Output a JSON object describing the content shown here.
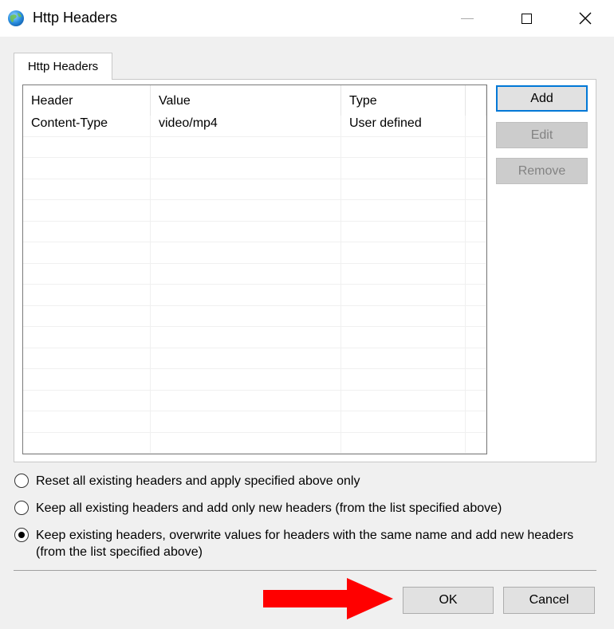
{
  "window": {
    "title": "Http Headers",
    "icon": "globe-icon",
    "controls": {
      "minimize_icon": "minimize-icon",
      "maximize_icon": "maximize-icon",
      "close_icon": "close-icon"
    }
  },
  "tabs": [
    {
      "label": "Http Headers",
      "active": true
    }
  ],
  "table": {
    "columns": [
      "Header",
      "Value",
      "Type"
    ],
    "rows": [
      {
        "header": "Content-Type",
        "value": "video/mp4",
        "type": "User defined"
      }
    ]
  },
  "side_buttons": {
    "add": {
      "label": "Add",
      "enabled": true
    },
    "edit": {
      "label": "Edit",
      "enabled": false
    },
    "remove": {
      "label": "Remove",
      "enabled": false
    }
  },
  "options": [
    {
      "label": "Reset all existing headers and apply specified above only",
      "selected": false
    },
    {
      "label": "Keep all existing headers and add only new headers (from the list specified above)",
      "selected": false
    },
    {
      "label": "Keep existing headers, overwrite values for headers with the same name and add new headers (from the list specified above)",
      "selected": true
    }
  ],
  "footer": {
    "ok_label": "OK",
    "cancel_label": "Cancel"
  },
  "annotation": {
    "arrow_color": "#ff0000",
    "arrow_icon": "right-arrow-icon"
  }
}
